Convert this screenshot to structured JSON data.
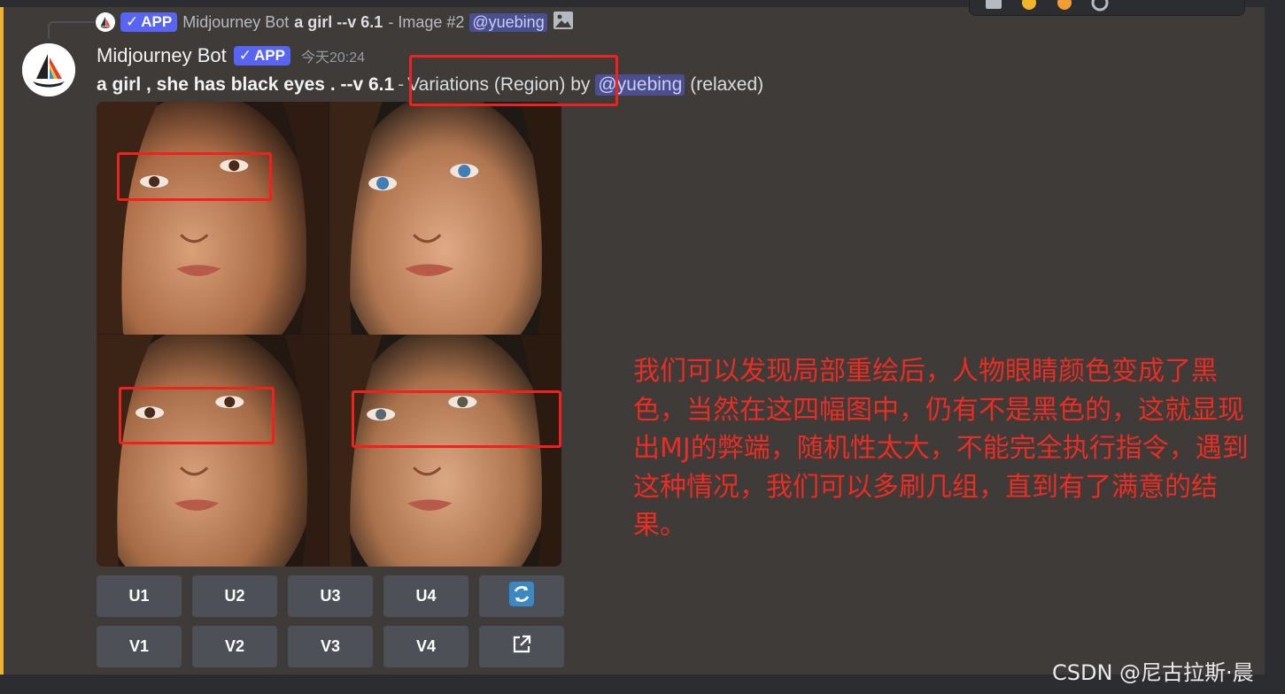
{
  "reply": {
    "bot_name": "Midjourney Bot",
    "app_badge": "APP",
    "ref_prompt": "a girl --v 6.1",
    "ref_suffix": "- Image #2",
    "mention": "@yuebing"
  },
  "message": {
    "username": "Midjourney Bot",
    "app_badge": "APP",
    "timestamp": "今天20:24",
    "prompt": "a girl , she has black eyes . --v 6.1",
    "separator": "-",
    "action": "Variations (Region) by",
    "mention": "@yuebing",
    "mode": "(relaxed)"
  },
  "buttons": {
    "row1": [
      "U1",
      "U2",
      "U3",
      "U4"
    ],
    "row2": [
      "V1",
      "V2",
      "V3",
      "V4"
    ],
    "reroll_icon": "refresh-icon",
    "web_icon": "external-link-icon"
  },
  "annotation": "我们可以发现局部重绘后，人物眼睛颜色变成了黑色，当然在这四幅图中，仍有不是黑色的，这就显现出MJ的弊端，随机性太大，不能完全执行指令，遇到这种情况，我们可以多刷几组，直到有了满意的结果。",
  "watermark": "CSDN @尼古拉斯·晨",
  "colors": {
    "accent": "#5865f2",
    "highlight_box": "#f0221b",
    "annotation_text": "#ea2c23",
    "mention_bar": "#f0b232"
  },
  "images": [
    {
      "eye_color": "brown"
    },
    {
      "eye_color": "blue"
    },
    {
      "eye_color": "brown"
    },
    {
      "eye_color": "gray-blue"
    }
  ]
}
